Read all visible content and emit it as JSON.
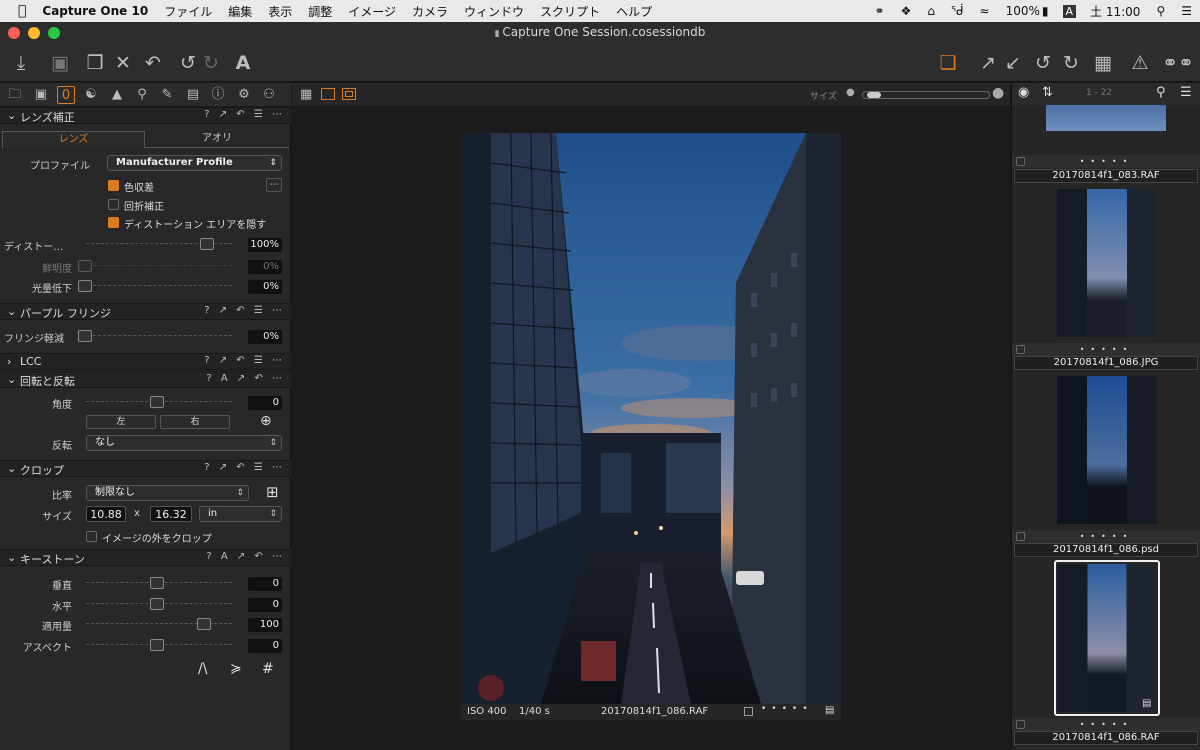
{
  "menubar": {
    "app_name": "Capture One 10",
    "items": [
      "ファイル",
      "編集",
      "表示",
      "調整",
      "イメージ",
      "カメラ",
      "ウィンドウ",
      "スクリプト",
      "ヘルプ"
    ],
    "battery": "100%",
    "input_indicator": "A",
    "clock": "土 11:00"
  },
  "window": {
    "title": "Capture One Session.cosessiondb"
  },
  "lens": {
    "title": "レンズ補正",
    "tab_lens": "レンズ",
    "tab_tilt": "アオリ",
    "profile_label": "プロファイル",
    "profile_value": "Manufacturer Profile",
    "chk_chromatic": "色収差",
    "chk_diffraction": "回折補正",
    "chk_hide_distortion": "ディストーション エリアを隠す",
    "distortion_label": "ディストー…",
    "distortion_value": "100%",
    "sharpness_label": "鮮明度",
    "sharpness_value": "0%",
    "falloff_label": "光量低下",
    "falloff_value": "0%"
  },
  "purple": {
    "title": "パープル フリンジ",
    "label": "フリンジ軽減",
    "value": "0%"
  },
  "lcc": {
    "title": "LCC"
  },
  "rotation": {
    "title": "回転と反転",
    "angle_label": "角度",
    "angle_value": "0",
    "left_btn": "左",
    "right_btn": "右",
    "flip_label": "反転",
    "flip_value": "なし"
  },
  "crop": {
    "title": "クロップ",
    "ratio_label": "比率",
    "ratio_value": "制限なし",
    "size_label": "サイズ",
    "width": "10.88",
    "x": "x",
    "height": "16.32",
    "unit": "in",
    "outside_label": "イメージの外をクロップ"
  },
  "keystone": {
    "title": "キーストーン",
    "vertical_label": "垂直",
    "vertical_value": "0",
    "horizontal_label": "水平",
    "horizontal_value": "0",
    "amount_label": "適用量",
    "amount_value": "100",
    "aspect_label": "アスペクト",
    "aspect_value": "0"
  },
  "viewer": {
    "size_label": "サイズ",
    "iso": "ISO 400",
    "shutter": "1/40 s",
    "filename": "20170814f1_086.RAF"
  },
  "browser": {
    "count": "1 - 22",
    "thumbs": [
      "20170814f1_083.RAF",
      "20170814f1_086.JPG",
      "20170814f1_086.psd",
      "20170814f1_086.RAF"
    ]
  },
  "accent_color": "#e07b20"
}
